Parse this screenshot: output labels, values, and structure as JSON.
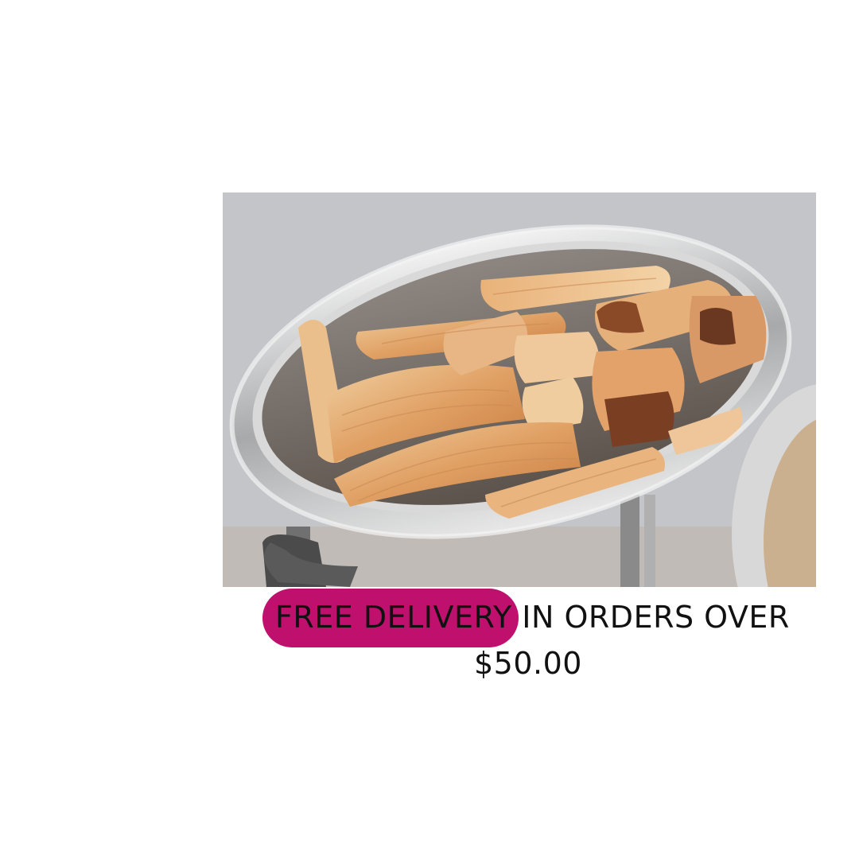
{
  "image": {
    "alt": "",
    "icon": "tamales-photo"
  },
  "promo": {
    "highlight": "FREE DELIVERY",
    "rest": " IN ORDERS OVER",
    "amount": "$50.00"
  },
  "colors": {
    "pill": "#c0106e",
    "text": "#111111",
    "background": "#ffffff"
  }
}
